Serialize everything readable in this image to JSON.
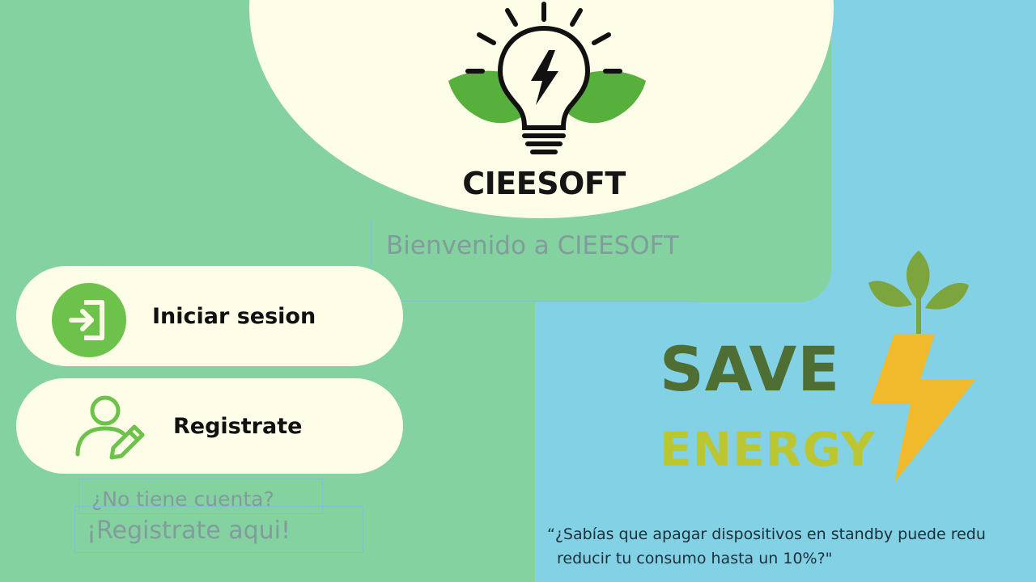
{
  "app": {
    "brand_name": "CIEESOFT",
    "welcome": "Bienvenido a CIEESOFT"
  },
  "actions": {
    "login_label": "Iniciar sesion",
    "register_label": "Registrate",
    "no_account_text": "¿No tiene cuenta?",
    "register_link_text": "¡Registrate aqui!"
  },
  "promo": {
    "save_word": "SAVE",
    "energy_word": "ENERGY",
    "tip_line1": "“¿Sabías que apagar dispositivos en standby puede redu",
    "tip_line2": "reducir tu consumo hasta un 10%?\""
  },
  "icons": {
    "logo": "lightbulb-leaf-logo-icon",
    "login": "sign-in-icon",
    "register": "user-edit-icon",
    "save_energy": "plant-lightning-icon"
  },
  "colors": {
    "background_green": "#84D2A0",
    "right_panel_blue": "#82D1E5",
    "card_cream": "#FDFDE8",
    "accent_green": "#6CC24A",
    "muted_text": "#829B9C",
    "save_green": "#4F6E34",
    "energy_yellow_green": "#BCC631",
    "bolt_yellow": "#F1BA2C"
  }
}
